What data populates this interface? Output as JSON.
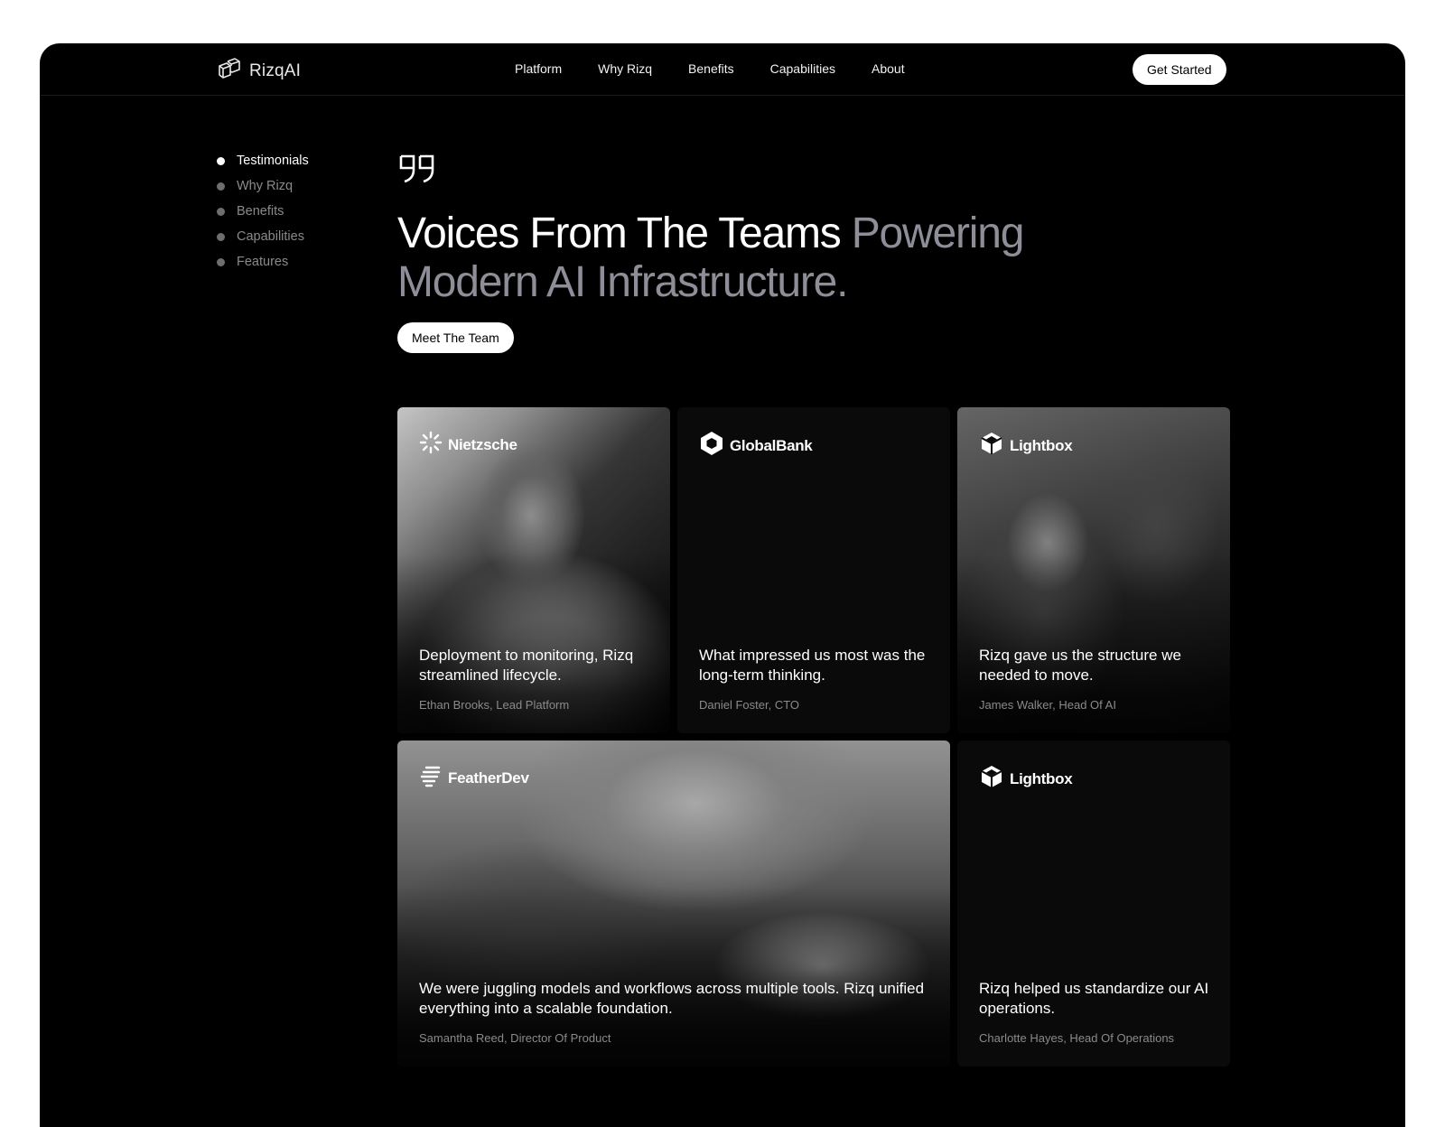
{
  "nav": {
    "logo_text": "RizqAI",
    "links": [
      "Platform",
      "Why Rizq",
      "Benefits",
      "Capabilities",
      "About"
    ],
    "cta_label": "Get Started"
  },
  "sidebar": {
    "items": [
      {
        "label": "Testimonials",
        "active": true
      },
      {
        "label": "Why Rizq",
        "active": false
      },
      {
        "label": "Benefits",
        "active": false
      },
      {
        "label": "Capabilities",
        "active": false
      },
      {
        "label": "Features",
        "active": false
      }
    ]
  },
  "hero": {
    "headline_white": "Voices From The Teams ",
    "headline_gray": "Powering Modern AI Infrastructure.",
    "button_label": "Meet The Team"
  },
  "testimonials": [
    {
      "brand": "Nietzsche",
      "brand_icon": "sunburst-icon",
      "quote": "Deployment to monitoring, Rizq streamlined lifecycle.",
      "author": "Ethan Brooks, Lead Platform",
      "image": "photo-man-smiling"
    },
    {
      "brand": "GlobalBank",
      "brand_icon": "hexagon-ring-icon",
      "quote": "What impressed us most was the long-term thinking.",
      "author": "Daniel Foster, CTO",
      "image": "none"
    },
    {
      "brand": "Lightbox",
      "brand_icon": "cube-icon",
      "quote": "Rizq gave us the structure we needed to move.",
      "author": "James Walker, Head Of AI",
      "image": "photo-meeting"
    },
    {
      "brand": "FeatherDev",
      "brand_icon": "feather-lines-icon",
      "quote": "We were juggling models and workflows across multiple tools. Rizq unified everything into a scalable foundation.",
      "author": "Samantha Reed, Director Of Product",
      "image": "photo-laptop-hands"
    },
    {
      "brand": "Lightbox",
      "brand_icon": "cube-icon",
      "quote": "Rizq helped us standardize our AI operations.",
      "author": "Charlotte Hayes, Head Of Operations",
      "image": "none"
    }
  ],
  "colors": {
    "background": "#000000",
    "accent_gray": "#8d8e98",
    "card": "#0a0a0a",
    "muted_text": "#8a8a8a"
  }
}
